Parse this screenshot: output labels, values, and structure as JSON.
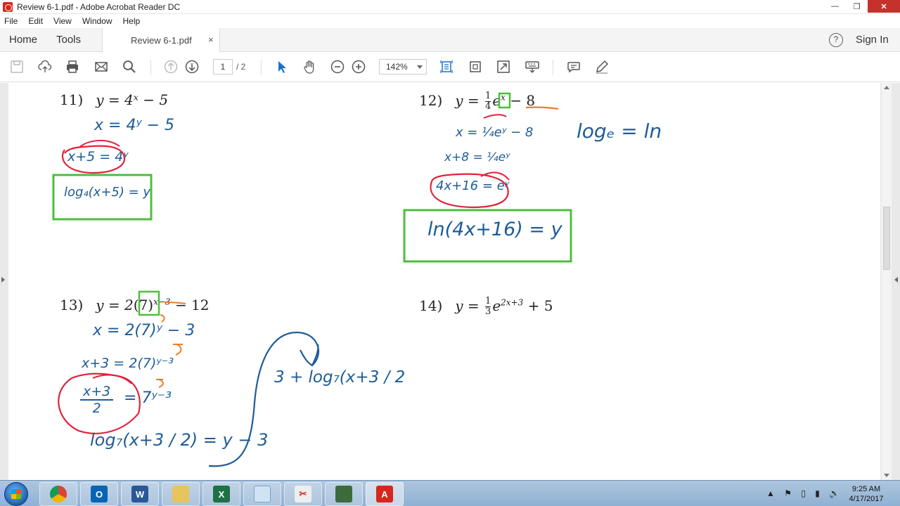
{
  "window": {
    "title": "Review 6-1.pdf - Adobe Acrobat Reader DC",
    "minimize": "—",
    "restore": "❐",
    "close": "✕"
  },
  "menu": [
    "File",
    "Edit",
    "View",
    "Window",
    "Help"
  ],
  "tabs": {
    "home": "Home",
    "tools": "Tools",
    "document": "Review 6-1.pdf",
    "close": "×",
    "help": "?",
    "sign_in": "Sign In"
  },
  "toolbar": {
    "page_current": "1",
    "page_total": "/ 2",
    "zoom": "142%",
    "icons": [
      "save-icon",
      "upload-icon",
      "print-icon",
      "email-icon",
      "search-icon",
      "page-up-icon",
      "page-down-icon",
      "select-arrow-icon",
      "hand-icon",
      "zoom-out-icon",
      "zoom-in-icon",
      "fit-page-icon",
      "rotate-icon",
      "fullscreen-icon",
      "keyboard-icon",
      "comment-icon",
      "highlight-pen-icon"
    ]
  },
  "document": {
    "problems": [
      {
        "num": "11)",
        "equation": "y = 4ˣ − 5"
      },
      {
        "num": "12)",
        "equation_prefix": "y =",
        "fraction_num": "1",
        "fraction_den": "4",
        "base": "e",
        "exp": "x",
        "suffix": "− 8"
      },
      {
        "num": "13)",
        "equation_prefix": "y = 2",
        "paren": "(7)",
        "exp": "x−3",
        "suffix": "− 12"
      },
      {
        "num": "14)",
        "equation_prefix": "y =",
        "fraction_num": "1",
        "fraction_den": "3",
        "base": "e",
        "exp": "2x+3",
        "suffix": "+ 5"
      }
    ],
    "handwriting": {
      "p11_line1": "x = 4ʸ − 5",
      "p11_line2": "x+5 = 4ʸ",
      "p11_answer": "log₄(x+5) = y",
      "p12_line1": "x = ¼eʸ − 8",
      "p12_line2": "x+8 = ¼eʸ",
      "p12_line3": "4x+16 = eʸ",
      "p12_answer": "ln(4x+16) = y",
      "p12_note": "logₑ = ln",
      "p13_line1": "x = 2(7)ʸ − 3",
      "p13_line2": "x+3 = 2(7)ʸ⁻³",
      "p13_line3_num": "x+3",
      "p13_line3_den": "2",
      "p13_line3_rhs": "= 7ʸ⁻³",
      "p13_line4": "log₇(x+3 / 2) = y − 3",
      "p13_note": "3 + log₇(x+3 / 2"
    }
  },
  "taskbar": {
    "apps": [
      "chrome",
      "outlook",
      "word",
      "file-explorer",
      "excel",
      "notepad",
      "snipping-tool",
      "projector",
      "acrobat"
    ],
    "time": "9:25 AM",
    "date": "4/17/2017"
  },
  "colors": {
    "ink_blue": "#1d5c98",
    "ink_red": "#e0233a",
    "ink_orange": "#f07b2a",
    "box_green": "#4cbf3c",
    "acrobat_red": "#d7261c"
  }
}
